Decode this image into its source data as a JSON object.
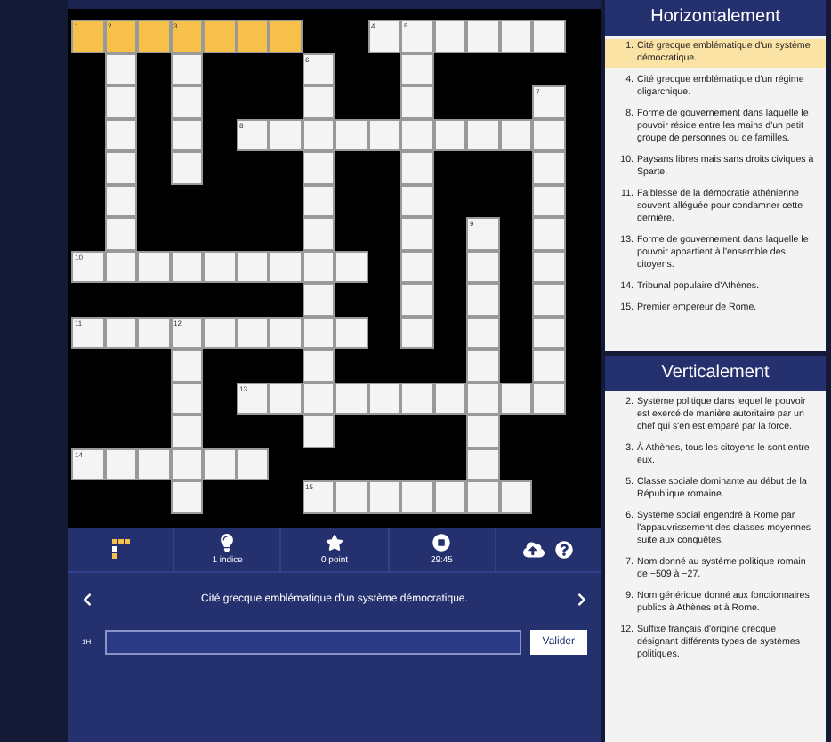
{
  "grid": [
    [
      {
        "kind": "open",
        "number": "1",
        "selected": true
      },
      {
        "kind": "open",
        "number": "2",
        "selected": true
      },
      {
        "kind": "open",
        "selected": true
      },
      {
        "kind": "open",
        "number": "3",
        "selected": true
      },
      {
        "kind": "open",
        "selected": true
      },
      {
        "kind": "open",
        "selected": true
      },
      {
        "kind": "open",
        "selected": true
      },
      {
        "kind": "block"
      },
      {
        "kind": "block"
      },
      {
        "kind": "open",
        "number": "4",
        "selected": false
      },
      {
        "kind": "open",
        "number": "5",
        "selected": false
      },
      {
        "kind": "open",
        "selected": false
      },
      {
        "kind": "open",
        "selected": false
      },
      {
        "kind": "open",
        "selected": false
      },
      {
        "kind": "open",
        "selected": false
      }
    ],
    [
      {
        "kind": "block"
      },
      {
        "kind": "open",
        "selected": false
      },
      {
        "kind": "block"
      },
      {
        "kind": "open",
        "selected": false
      },
      {
        "kind": "block"
      },
      {
        "kind": "block"
      },
      {
        "kind": "block"
      },
      {
        "kind": "open",
        "number": "6",
        "selected": false
      },
      {
        "kind": "block"
      },
      {
        "kind": "block"
      },
      {
        "kind": "open",
        "selected": false
      },
      {
        "kind": "block"
      },
      {
        "kind": "block"
      },
      {
        "kind": "block"
      },
      {
        "kind": "block"
      }
    ],
    [
      {
        "kind": "block"
      },
      {
        "kind": "open",
        "selected": false
      },
      {
        "kind": "block"
      },
      {
        "kind": "open",
        "selected": false
      },
      {
        "kind": "block"
      },
      {
        "kind": "block"
      },
      {
        "kind": "block"
      },
      {
        "kind": "open",
        "selected": false
      },
      {
        "kind": "block"
      },
      {
        "kind": "block"
      },
      {
        "kind": "open",
        "selected": false
      },
      {
        "kind": "block"
      },
      {
        "kind": "block"
      },
      {
        "kind": "block"
      },
      {
        "kind": "open",
        "number": "7",
        "selected": false
      }
    ],
    [
      {
        "kind": "block"
      },
      {
        "kind": "open",
        "selected": false
      },
      {
        "kind": "block"
      },
      {
        "kind": "open",
        "selected": false
      },
      {
        "kind": "block"
      },
      {
        "kind": "open",
        "number": "8",
        "selected": false
      },
      {
        "kind": "open",
        "selected": false
      },
      {
        "kind": "open",
        "selected": false
      },
      {
        "kind": "open",
        "selected": false
      },
      {
        "kind": "open",
        "selected": false
      },
      {
        "kind": "open",
        "selected": false
      },
      {
        "kind": "open",
        "selected": false
      },
      {
        "kind": "open",
        "selected": false
      },
      {
        "kind": "open",
        "selected": false
      },
      {
        "kind": "open",
        "selected": false
      }
    ],
    [
      {
        "kind": "block"
      },
      {
        "kind": "open",
        "selected": false
      },
      {
        "kind": "block"
      },
      {
        "kind": "open",
        "selected": false
      },
      {
        "kind": "block"
      },
      {
        "kind": "block"
      },
      {
        "kind": "block"
      },
      {
        "kind": "open",
        "selected": false
      },
      {
        "kind": "block"
      },
      {
        "kind": "block"
      },
      {
        "kind": "open",
        "selected": false
      },
      {
        "kind": "block"
      },
      {
        "kind": "block"
      },
      {
        "kind": "block"
      },
      {
        "kind": "open",
        "selected": false
      }
    ],
    [
      {
        "kind": "block"
      },
      {
        "kind": "open",
        "selected": false
      },
      {
        "kind": "block"
      },
      {
        "kind": "block"
      },
      {
        "kind": "block"
      },
      {
        "kind": "block"
      },
      {
        "kind": "block"
      },
      {
        "kind": "open",
        "selected": false
      },
      {
        "kind": "block"
      },
      {
        "kind": "block"
      },
      {
        "kind": "open",
        "selected": false
      },
      {
        "kind": "block"
      },
      {
        "kind": "block"
      },
      {
        "kind": "block"
      },
      {
        "kind": "open",
        "selected": false
      }
    ],
    [
      {
        "kind": "block"
      },
      {
        "kind": "open",
        "selected": false
      },
      {
        "kind": "block"
      },
      {
        "kind": "block"
      },
      {
        "kind": "block"
      },
      {
        "kind": "block"
      },
      {
        "kind": "block"
      },
      {
        "kind": "open",
        "selected": false
      },
      {
        "kind": "block"
      },
      {
        "kind": "block"
      },
      {
        "kind": "open",
        "selected": false
      },
      {
        "kind": "block"
      },
      {
        "kind": "open",
        "number": "9",
        "selected": false
      },
      {
        "kind": "block"
      },
      {
        "kind": "open",
        "selected": false
      }
    ],
    [
      {
        "kind": "open",
        "number": "10",
        "selected": false
      },
      {
        "kind": "open",
        "selected": false
      },
      {
        "kind": "open",
        "selected": false
      },
      {
        "kind": "open",
        "selected": false
      },
      {
        "kind": "open",
        "selected": false
      },
      {
        "kind": "open",
        "selected": false
      },
      {
        "kind": "open",
        "selected": false
      },
      {
        "kind": "open",
        "selected": false
      },
      {
        "kind": "open",
        "selected": false
      },
      {
        "kind": "block"
      },
      {
        "kind": "open",
        "selected": false
      },
      {
        "kind": "block"
      },
      {
        "kind": "open",
        "selected": false
      },
      {
        "kind": "block"
      },
      {
        "kind": "open",
        "selected": false
      }
    ],
    [
      {
        "kind": "block"
      },
      {
        "kind": "block"
      },
      {
        "kind": "block"
      },
      {
        "kind": "block"
      },
      {
        "kind": "block"
      },
      {
        "kind": "block"
      },
      {
        "kind": "block"
      },
      {
        "kind": "open",
        "selected": false
      },
      {
        "kind": "block"
      },
      {
        "kind": "block"
      },
      {
        "kind": "open",
        "selected": false
      },
      {
        "kind": "block"
      },
      {
        "kind": "open",
        "selected": false
      },
      {
        "kind": "block"
      },
      {
        "kind": "open",
        "selected": false
      }
    ],
    [
      {
        "kind": "open",
        "number": "11",
        "selected": false
      },
      {
        "kind": "open",
        "selected": false
      },
      {
        "kind": "open",
        "selected": false
      },
      {
        "kind": "open",
        "number": "12",
        "selected": false
      },
      {
        "kind": "open",
        "selected": false
      },
      {
        "kind": "open",
        "selected": false
      },
      {
        "kind": "open",
        "selected": false
      },
      {
        "kind": "open",
        "selected": false
      },
      {
        "kind": "open",
        "selected": false
      },
      {
        "kind": "block"
      },
      {
        "kind": "open",
        "selected": false
      },
      {
        "kind": "block"
      },
      {
        "kind": "open",
        "selected": false
      },
      {
        "kind": "block"
      },
      {
        "kind": "open",
        "selected": false
      }
    ],
    [
      {
        "kind": "block"
      },
      {
        "kind": "block"
      },
      {
        "kind": "block"
      },
      {
        "kind": "open",
        "selected": false
      },
      {
        "kind": "block"
      },
      {
        "kind": "block"
      },
      {
        "kind": "block"
      },
      {
        "kind": "open",
        "selected": false
      },
      {
        "kind": "block"
      },
      {
        "kind": "block"
      },
      {
        "kind": "block"
      },
      {
        "kind": "block"
      },
      {
        "kind": "open",
        "selected": false
      },
      {
        "kind": "block"
      },
      {
        "kind": "open",
        "selected": false
      }
    ],
    [
      {
        "kind": "block"
      },
      {
        "kind": "block"
      },
      {
        "kind": "block"
      },
      {
        "kind": "open",
        "selected": false
      },
      {
        "kind": "block"
      },
      {
        "kind": "open",
        "number": "13",
        "selected": false
      },
      {
        "kind": "open",
        "selected": false
      },
      {
        "kind": "open",
        "selected": false
      },
      {
        "kind": "open",
        "selected": false
      },
      {
        "kind": "open",
        "selected": false
      },
      {
        "kind": "open",
        "selected": false
      },
      {
        "kind": "open",
        "selected": false
      },
      {
        "kind": "open",
        "selected": false
      },
      {
        "kind": "open",
        "selected": false
      },
      {
        "kind": "open",
        "selected": false
      }
    ],
    [
      {
        "kind": "block"
      },
      {
        "kind": "block"
      },
      {
        "kind": "block"
      },
      {
        "kind": "open",
        "selected": false
      },
      {
        "kind": "block"
      },
      {
        "kind": "block"
      },
      {
        "kind": "block"
      },
      {
        "kind": "open",
        "selected": false
      },
      {
        "kind": "block"
      },
      {
        "kind": "block"
      },
      {
        "kind": "block"
      },
      {
        "kind": "block"
      },
      {
        "kind": "open",
        "selected": false
      },
      {
        "kind": "block"
      },
      {
        "kind": "block"
      }
    ],
    [
      {
        "kind": "open",
        "number": "14",
        "selected": false
      },
      {
        "kind": "open",
        "selected": false
      },
      {
        "kind": "open",
        "selected": false
      },
      {
        "kind": "open",
        "selected": false
      },
      {
        "kind": "open",
        "selected": false
      },
      {
        "kind": "open",
        "selected": false
      },
      {
        "kind": "block"
      },
      {
        "kind": "block"
      },
      {
        "kind": "block"
      },
      {
        "kind": "block"
      },
      {
        "kind": "block"
      },
      {
        "kind": "block"
      },
      {
        "kind": "open",
        "selected": false
      },
      {
        "kind": "block"
      },
      {
        "kind": "block"
      }
    ],
    [
      {
        "kind": "block"
      },
      {
        "kind": "block"
      },
      {
        "kind": "block"
      },
      {
        "kind": "open",
        "selected": false
      },
      {
        "kind": "block"
      },
      {
        "kind": "block"
      },
      {
        "kind": "block"
      },
      {
        "kind": "open",
        "number": "15",
        "selected": false
      },
      {
        "kind": "open",
        "selected": false
      },
      {
        "kind": "open",
        "selected": false
      },
      {
        "kind": "open",
        "selected": false
      },
      {
        "kind": "open",
        "selected": false
      },
      {
        "kind": "open",
        "selected": false
      },
      {
        "kind": "open",
        "selected": false
      },
      {
        "kind": "block"
      }
    ]
  ],
  "toolbar": [
    {
      "kind": "grid"
    },
    {
      "kind": "hint",
      "label": "1 indice"
    },
    {
      "kind": "score",
      "label": "0 point"
    },
    {
      "kind": "timer",
      "label": "29:45"
    },
    {
      "kind": "actions"
    }
  ],
  "current_clue": "Cité grecque emblématique d'un système démocratique.",
  "answer": {
    "label": "1H",
    "button": "Valider"
  },
  "across": {
    "title": "Horizontalement",
    "clues": [
      {
        "number": "1.",
        "text": "Cité grecque emblématique d'un système démocratique.",
        "selected": true
      },
      {
        "number": "4.",
        "text": "Cité grecque emblématique d'un régime oligarchique.",
        "selected": false
      },
      {
        "number": "8.",
        "text": "Forme de gouvernement dans laquelle le pouvoir réside entre les mains d'un petit groupe de personnes ou de familles.",
        "selected": false
      },
      {
        "number": "10.",
        "text": "Paysans libres mais sans droits civiques à Sparte.",
        "selected": false
      },
      {
        "number": "11.",
        "text": "Faiblesse de la démocratie athénienne souvent alléguée pour condamner cette dernière.",
        "selected": false
      },
      {
        "number": "13.",
        "text": "Forme de gouvernement dans laquelle le pouvoir appartient à l'ensemble des citoyens.",
        "selected": false
      },
      {
        "number": "14.",
        "text": "Tribunal populaire d'Athènes.",
        "selected": false
      },
      {
        "number": "15.",
        "text": "Premier empereur de Rome.",
        "selected": false
      }
    ]
  },
  "down": {
    "title": "Verticalement",
    "clues": [
      {
        "number": "2.",
        "text": "Système politique dans lequel le pouvoir est exercé de manière autoritaire par un chef qui s'en est emparé par la force.",
        "selected": false
      },
      {
        "number": "3.",
        "text": "À Athènes, tous les citoyens le sont entre eux.",
        "selected": false
      },
      {
        "number": "5.",
        "text": "Classe sociale dominante au début de la République romaine.",
        "selected": false
      },
      {
        "number": "6.",
        "text": "Système social engendré à Rome par l'appauvrissement des classes moyennes suite aux conquêtes.",
        "selected": false
      },
      {
        "number": "7.",
        "text": "Nom donné au système politique romain de −509 à −27.",
        "selected": false
      },
      {
        "number": "9.",
        "text": "Nom générique donné aux fonctionnaires publics à Athènes et à Rome.",
        "selected": false
      },
      {
        "number": "12.",
        "text": "Suffixe français d'origine grecque désignant différents types de systèmes politiques.",
        "selected": false
      }
    ]
  }
}
